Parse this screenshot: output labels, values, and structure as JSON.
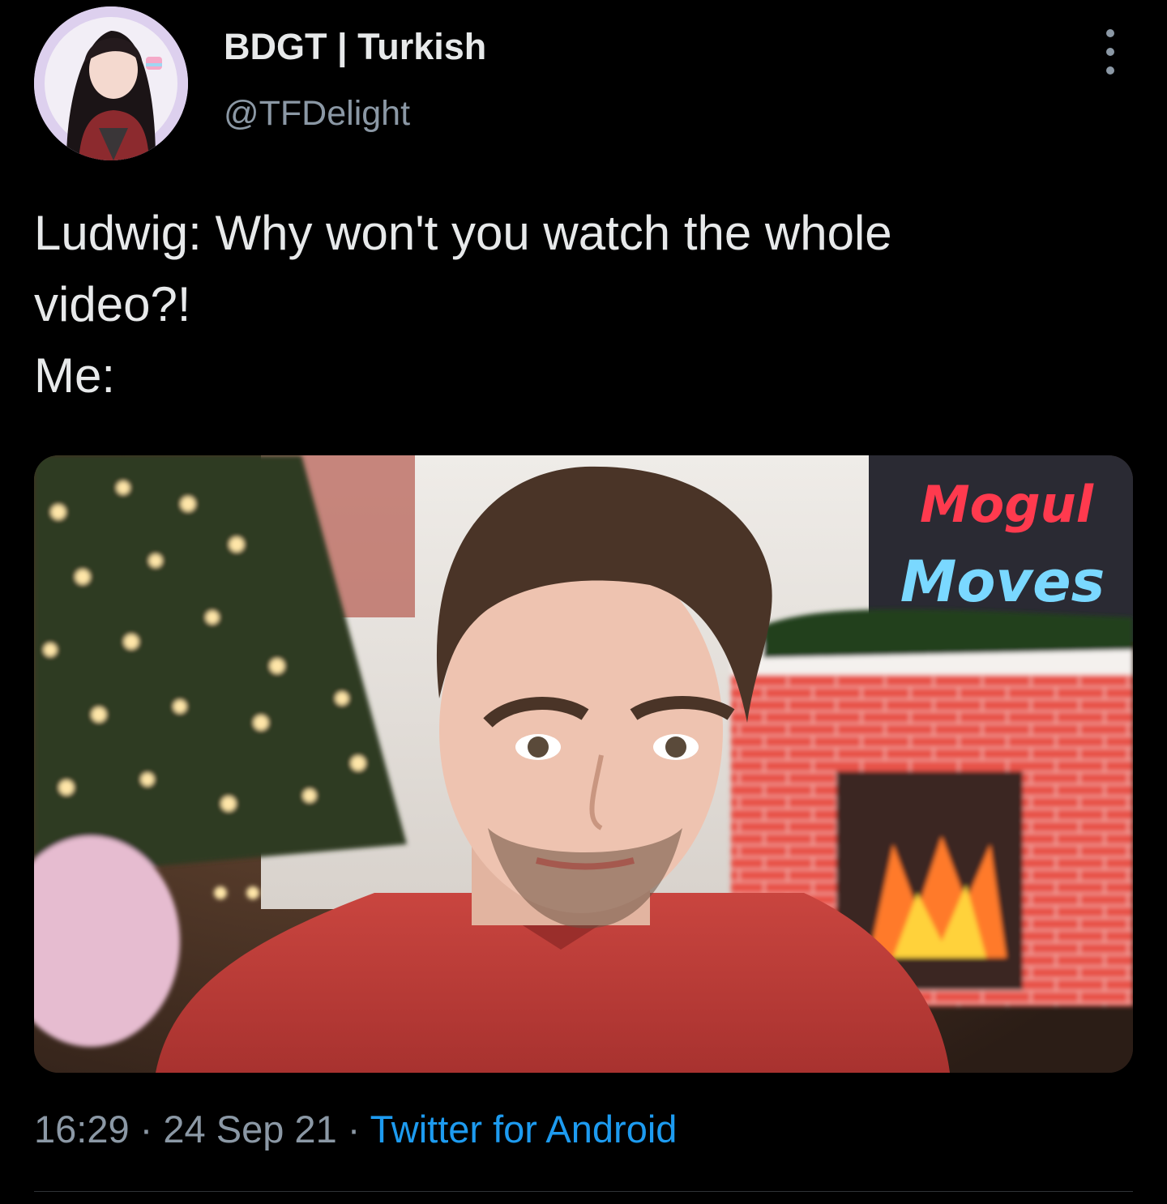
{
  "author": {
    "display_name": "BDGT | Turkish",
    "handle": "@TFDelight",
    "avatar_icon": "anime-avatar"
  },
  "more_icon": "more-vertical-icon",
  "tweet": {
    "lines": [
      "Ludwig: Why won't you watch the whole",
      "video?!",
      "Me:"
    ]
  },
  "media": {
    "sign_line1": "Mogul",
    "sign_line2": "Moves"
  },
  "meta": {
    "time": "16:29",
    "separator": " · ",
    "date": "24 Sep 21",
    "source": "Twitter for Android"
  },
  "colors": {
    "background": "#000000",
    "text": "#e7e9ea",
    "secondary": "#8b98a5",
    "link": "#1d9bf0"
  }
}
